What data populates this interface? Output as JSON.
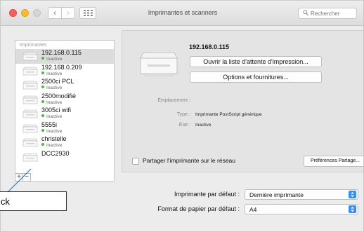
{
  "window": {
    "title": "Imprimantes et scanners",
    "search_placeholder": "Rechercher"
  },
  "sidebar": {
    "header": "Imprimantes",
    "printers": [
      {
        "name": "192.168.0.115",
        "status": "Inactive",
        "selected": true
      },
      {
        "name": "192.168.0.209",
        "status": "Inactive",
        "selected": false
      },
      {
        "name": "2500ci PCL",
        "status": "Inactive",
        "selected": false
      },
      {
        "name": "2500modifié",
        "status": "Inactive",
        "selected": false
      },
      {
        "name": "3005ci wifi",
        "status": "Inactive",
        "selected": false
      },
      {
        "name": "5555i",
        "status": "Inactive",
        "selected": false
      },
      {
        "name": "christelle",
        "status": "Inactive",
        "selected": false
      },
      {
        "name": "DCC2930",
        "status": "",
        "selected": false
      }
    ],
    "add_label": "+",
    "remove_label": "−"
  },
  "detail": {
    "printer_name": "192.168.0.115",
    "queue_button": "Ouvrir la liste d'attente d'impression...",
    "options_button": "Options et fournitures...",
    "location_label": "Emplacement :",
    "type_label": "Type :",
    "type_value": "Imprimante PostScript générique",
    "state_label": "État :",
    "state_value": "Inactive",
    "share_label": "Partager l'imprimante sur le réseau",
    "share_checked": false,
    "share_prefs_button": "Préférences Partage..."
  },
  "defaults": {
    "printer_label": "Imprimante par défaut :",
    "printer_value": "Dernière imprimante",
    "paper_label": "Format de papier par défaut :",
    "paper_value": "A4"
  },
  "annotation": {
    "text": "ick"
  },
  "colors": {
    "status_dot": "#55b14b",
    "select_accent": "#3a8df2",
    "selected_row": "#dcdcdc"
  }
}
